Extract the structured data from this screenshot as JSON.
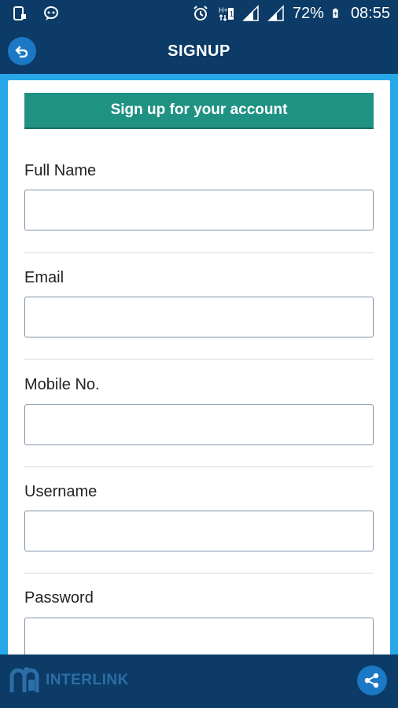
{
  "status_bar": {
    "battery": "72%",
    "time": "08:55"
  },
  "header": {
    "title": "SIGNUP"
  },
  "form": {
    "banner": "Sign up for your account",
    "fields": [
      {
        "label": "Full Name",
        "value": ""
      },
      {
        "label": "Email",
        "value": ""
      },
      {
        "label": "Mobile No.",
        "value": ""
      },
      {
        "label": "Username",
        "value": ""
      },
      {
        "label": "Password",
        "value": ""
      }
    ]
  },
  "footer": {
    "brand": "INTERLINK"
  },
  "icons": {
    "back": "back-arrow-icon",
    "share": "share-icon"
  },
  "colors": {
    "primary_dark": "#0b3b66",
    "accent_blue": "#27a7e7",
    "banner_teal": "#1f9283"
  }
}
